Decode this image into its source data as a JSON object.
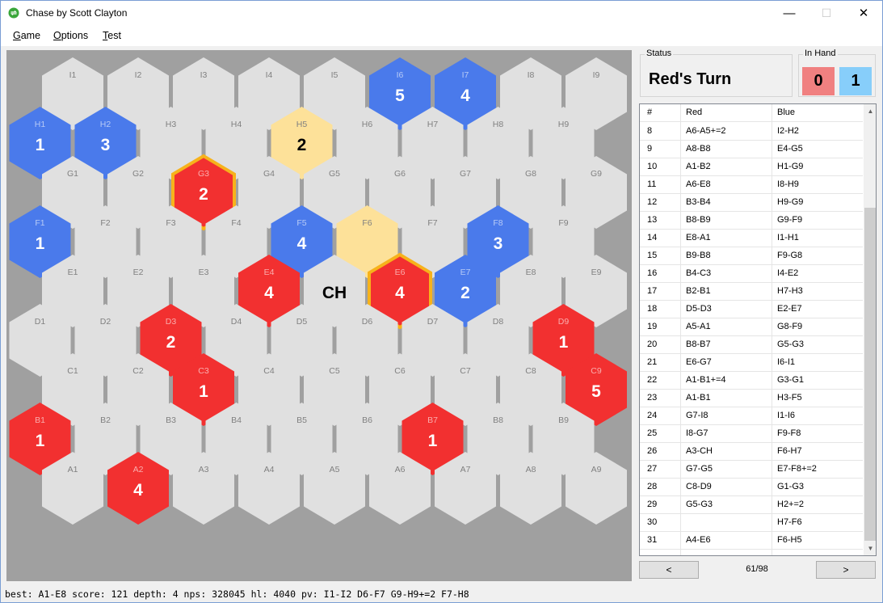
{
  "window": {
    "title": "Chase by Scott Clayton"
  },
  "menu": [
    {
      "mnemonic": "G",
      "rest": "ame"
    },
    {
      "mnemonic": "O",
      "rest": "ptions"
    },
    {
      "mnemonic": "T",
      "rest": "est"
    }
  ],
  "colors": {
    "red": "#f23030",
    "blue": "#4a7aeb",
    "empty": "#e0e0e0",
    "highlight": "#fde199",
    "selected_border": "#f7b21b",
    "board_bg": "#a0a0a0"
  },
  "board": {
    "rows": [
      {
        "row": "I",
        "cells": [
          {
            "label": "I1",
            "state": "empty"
          },
          {
            "label": "I2",
            "state": "empty"
          },
          {
            "label": "I3",
            "state": "empty"
          },
          {
            "label": "I4",
            "state": "empty"
          },
          {
            "label": "I5",
            "state": "empty"
          },
          {
            "label": "I6",
            "state": "blue",
            "value": "5"
          },
          {
            "label": "I7",
            "state": "blue",
            "value": "4"
          },
          {
            "label": "I8",
            "state": "empty"
          },
          {
            "label": "I9",
            "state": "empty"
          }
        ]
      },
      {
        "row": "H",
        "cells": [
          {
            "label": "H1",
            "state": "blue",
            "value": "1"
          },
          {
            "label": "H2",
            "state": "blue",
            "value": "3"
          },
          {
            "label": "H3",
            "state": "empty"
          },
          {
            "label": "H4",
            "state": "empty"
          },
          {
            "label": "H5",
            "state": "highlight",
            "value": "2"
          },
          {
            "label": "H6",
            "state": "empty"
          },
          {
            "label": "H7",
            "state": "empty"
          },
          {
            "label": "H8",
            "state": "empty"
          },
          {
            "label": "H9",
            "state": "empty"
          }
        ]
      },
      {
        "row": "G",
        "cells": [
          {
            "label": "G1",
            "state": "empty"
          },
          {
            "label": "G2",
            "state": "empty"
          },
          {
            "label": "G3",
            "state": "red",
            "value": "2",
            "selected": true
          },
          {
            "label": "G4",
            "state": "empty"
          },
          {
            "label": "G5",
            "state": "empty"
          },
          {
            "label": "G6",
            "state": "empty"
          },
          {
            "label": "G7",
            "state": "empty"
          },
          {
            "label": "G8",
            "state": "empty"
          },
          {
            "label": "G9",
            "state": "empty"
          }
        ]
      },
      {
        "row": "F",
        "cells": [
          {
            "label": "F1",
            "state": "blue",
            "value": "1"
          },
          {
            "label": "F2",
            "state": "empty"
          },
          {
            "label": "F3",
            "state": "empty"
          },
          {
            "label": "F4",
            "state": "empty"
          },
          {
            "label": "F5",
            "state": "blue",
            "value": "4"
          },
          {
            "label": "F6",
            "state": "highlight"
          },
          {
            "label": "F7",
            "state": "empty"
          },
          {
            "label": "F8",
            "state": "blue",
            "value": "3"
          },
          {
            "label": "F9",
            "state": "empty"
          }
        ]
      },
      {
        "row": "E",
        "cells": [
          {
            "label": "E1",
            "state": "empty"
          },
          {
            "label": "E2",
            "state": "empty"
          },
          {
            "label": "E3",
            "state": "empty"
          },
          {
            "label": "E4",
            "state": "red",
            "value": "4"
          },
          {
            "label": "",
            "state": "empty",
            "value": "CH",
            "center": true
          },
          {
            "label": "E6",
            "state": "red",
            "value": "4",
            "selected": true
          },
          {
            "label": "E7",
            "state": "blue",
            "value": "2"
          },
          {
            "label": "E8",
            "state": "empty"
          },
          {
            "label": "E9",
            "state": "empty"
          }
        ]
      },
      {
        "row": "D",
        "cells": [
          {
            "label": "D1",
            "state": "empty"
          },
          {
            "label": "D2",
            "state": "empty"
          },
          {
            "label": "D3",
            "state": "red",
            "value": "2"
          },
          {
            "label": "D4",
            "state": "empty"
          },
          {
            "label": "D5",
            "state": "empty"
          },
          {
            "label": "D6",
            "state": "empty"
          },
          {
            "label": "D7",
            "state": "empty"
          },
          {
            "label": "D8",
            "state": "empty"
          },
          {
            "label": "D9",
            "state": "red",
            "value": "1"
          }
        ]
      },
      {
        "row": "C",
        "cells": [
          {
            "label": "C1",
            "state": "empty"
          },
          {
            "label": "C2",
            "state": "empty"
          },
          {
            "label": "C3",
            "state": "red",
            "value": "1"
          },
          {
            "label": "C4",
            "state": "empty"
          },
          {
            "label": "C5",
            "state": "empty"
          },
          {
            "label": "C6",
            "state": "empty"
          },
          {
            "label": "C7",
            "state": "empty"
          },
          {
            "label": "C8",
            "state": "empty"
          },
          {
            "label": "C9",
            "state": "red",
            "value": "5"
          }
        ]
      },
      {
        "row": "B",
        "cells": [
          {
            "label": "B1",
            "state": "red",
            "value": "1"
          },
          {
            "label": "B2",
            "state": "empty"
          },
          {
            "label": "B3",
            "state": "empty"
          },
          {
            "label": "B4",
            "state": "empty"
          },
          {
            "label": "B5",
            "state": "empty"
          },
          {
            "label": "B6",
            "state": "empty"
          },
          {
            "label": "B7",
            "state": "red",
            "value": "1"
          },
          {
            "label": "B8",
            "state": "empty"
          },
          {
            "label": "B9",
            "state": "empty"
          }
        ]
      },
      {
        "row": "A",
        "cells": [
          {
            "label": "A1",
            "state": "empty"
          },
          {
            "label": "A2",
            "state": "red",
            "value": "4"
          },
          {
            "label": "A3",
            "state": "empty"
          },
          {
            "label": "A4",
            "state": "empty"
          },
          {
            "label": "A5",
            "state": "empty"
          },
          {
            "label": "A6",
            "state": "empty"
          },
          {
            "label": "A7",
            "state": "empty"
          },
          {
            "label": "A8",
            "state": "empty"
          },
          {
            "label": "A9",
            "state": "empty"
          }
        ]
      }
    ]
  },
  "status": {
    "label": "Status",
    "text": "Red's Turn"
  },
  "in_hand": {
    "label": "In Hand",
    "red": "0",
    "blue": "1"
  },
  "moves": {
    "headers": [
      "#",
      "Red",
      "Blue"
    ],
    "rows": [
      [
        "8",
        "A6-A5+=2",
        "I2-H2"
      ],
      [
        "9",
        "A8-B8",
        "E4-G5"
      ],
      [
        "10",
        "A1-B2",
        "H1-G9"
      ],
      [
        "11",
        "A6-E8",
        "I8-H9"
      ],
      [
        "12",
        "B3-B4",
        "H9-G9"
      ],
      [
        "13",
        "B8-B9",
        "G9-F9"
      ],
      [
        "14",
        "E8-A1",
        "I1-H1"
      ],
      [
        "15",
        "B9-B8",
        "F9-G8"
      ],
      [
        "16",
        "B4-C3",
        "I4-E2"
      ],
      [
        "17",
        "B2-B1",
        "H7-H3"
      ],
      [
        "18",
        "D5-D3",
        "E2-E7"
      ],
      [
        "19",
        "A5-A1",
        "G8-F9"
      ],
      [
        "20",
        "B8-B7",
        "G5-G3"
      ],
      [
        "21",
        "E6-G7",
        "I6-I1"
      ],
      [
        "22",
        "A1-B1+=4",
        "G3-G1"
      ],
      [
        "23",
        "A1-B1",
        "H3-F5"
      ],
      [
        "24",
        "G7-I8",
        "I1-I6"
      ],
      [
        "25",
        "I8-G7",
        "F9-F8"
      ],
      [
        "26",
        "A3-CH",
        "F6-H7"
      ],
      [
        "27",
        "G7-G5",
        "E7-F8+=2"
      ],
      [
        "28",
        "C8-D9",
        "G1-G3"
      ],
      [
        "29",
        "G5-G3",
        "H2+=2"
      ],
      [
        "30",
        "",
        "H7-F6"
      ],
      [
        "31",
        "A4-E6",
        "F6-H5"
      ]
    ]
  },
  "nav": {
    "prev": "<",
    "next": ">",
    "page": "61/98"
  },
  "engine_status": "best: A1-E8 score: 121 depth: 4 nps: 328045 hl: 4040 pv: I1-I2 D6-F7 G9-H9+=2 F7-H8"
}
